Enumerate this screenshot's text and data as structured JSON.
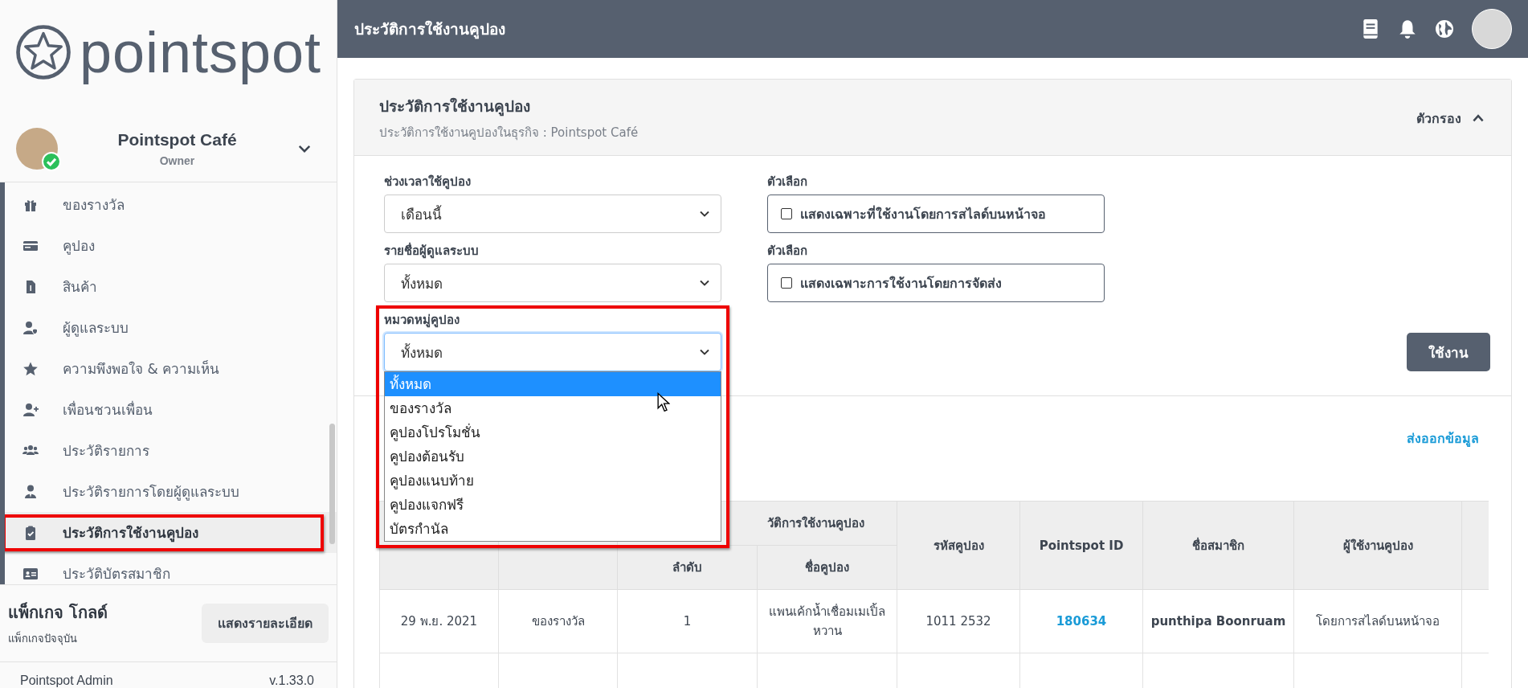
{
  "sidebar": {
    "logo": "pointspot",
    "business": {
      "name": "Pointspot Café",
      "role": "Owner"
    },
    "items": [
      {
        "label": "ของรางวัล",
        "selected": false
      },
      {
        "label": "คูปอง",
        "selected": false
      },
      {
        "label": "สินค้า",
        "selected": false
      },
      {
        "label": "ผู้ดูแลระบบ",
        "selected": false
      },
      {
        "label": "ความพึงพอใจ & ความเห็น",
        "selected": false
      },
      {
        "label": "เพื่อนชวนเพื่อน",
        "selected": false
      },
      {
        "label": "ประวัติรายการ",
        "selected": false
      },
      {
        "label": "ประวัติรายการโดยผู้ดูแลระบบ",
        "selected": false
      },
      {
        "label": "ประวัติการใช้งานคูปอง",
        "selected": true
      },
      {
        "label": "ประวัติบัตรสมาชิก",
        "selected": false
      }
    ],
    "package": {
      "name": "แพ็กเกจ โกลด์",
      "caption": "แพ็กเกจปัจจุบัน",
      "button": "แสดงรายละเอียด"
    },
    "footer": {
      "app": "Pointspot Admin",
      "version": "v.1.33.0"
    }
  },
  "topbar": {
    "title": "ประวัติการใช้งานคูปอง"
  },
  "card": {
    "title": "ประวัติการใช้งานคูปอง",
    "subtitle": "ประวัติการใช้งานคูปองในธุรกิจ : Pointspot Café",
    "filter_toggle": "ตัวกรอง",
    "expanded": true
  },
  "filters": {
    "selects": [
      {
        "label": "ช่วงเวลาใช้คูปอง",
        "value": "เดือนนี้"
      },
      {
        "label": "รายชื่อผู้ดูแลระบบ",
        "value": "ทั้งหมด"
      },
      {
        "label": "หมวดหมู่คูปอง",
        "value": "ทั้งหมด"
      }
    ],
    "checkboxes": [
      {
        "label": "ตัวเลือก",
        "text": "แสดงเฉพาะที่ใช้งานโดยการสไลด์บนหน้าจอ",
        "checked": false
      },
      {
        "label": "ตัวเลือก",
        "text": "แสดงเฉพาะการใช้งานโดยการจัดส่ง",
        "checked": false
      }
    ],
    "category_options": [
      {
        "label": "ทั้งหมด",
        "selected": true
      },
      {
        "label": "ของรางวัล",
        "selected": false
      },
      {
        "label": "คูปองโปรโมชั่น",
        "selected": false
      },
      {
        "label": "คูปองต้อนรับ",
        "selected": false
      },
      {
        "label": "คูปองแนบท้าย",
        "selected": false
      },
      {
        "label": "คูปองแจกฟรี",
        "selected": false
      },
      {
        "label": "บัตรกำนัล",
        "selected": false
      }
    ],
    "apply": "ใช้งาน"
  },
  "export": "ส่งออกข้อมูล",
  "table": {
    "group_header": "วัติการใช้งานคูปอง",
    "columns": [
      "",
      "",
      "ลำดับ",
      "ชื่อคูปอง",
      "รหัสคูปอง",
      "Pointspot ID",
      "ชื่อสมาชิก",
      "ผู้ใช้งานคูปอง"
    ],
    "rows": [
      {
        "cells": [
          "29 พ.ย. 2021",
          "ของรางวัล",
          "1",
          "แพนเค้กน้ำเชื่อมเมเปิ้ลหวาน",
          "1011 2532",
          "180634",
          "punthipa Boonruam",
          "โดยการสไลด์บนหน้าจอ"
        ]
      }
    ]
  }
}
